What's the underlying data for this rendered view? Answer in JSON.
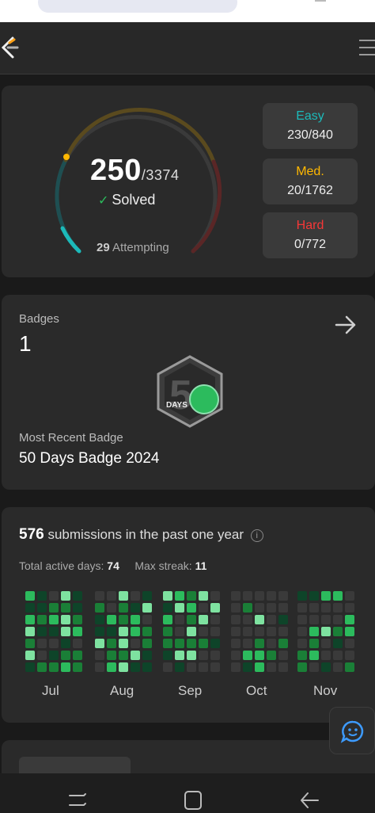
{
  "stats": {
    "solved": "250",
    "total": "/3374",
    "solved_label": "Solved",
    "attempting_count": "29",
    "attempting_label": "Attempting",
    "difficulties": [
      {
        "label": "Easy",
        "value": "230/840",
        "color": "#1cbaba"
      },
      {
        "label": "Med.",
        "value": "20/1762",
        "color": "#ffb800"
      },
      {
        "label": "Hard",
        "value": "0/772",
        "color": "#f63737"
      }
    ]
  },
  "badges": {
    "title": "Badges",
    "count": "1",
    "recent_label": "Most Recent Badge",
    "recent_name": "50 Days Badge 2024",
    "badge_text": "DAYS"
  },
  "submissions": {
    "count": "576",
    "text": "submissions in the past one year",
    "active_days_label": "Total active days:",
    "active_days": "74",
    "max_streak_label": "Max streak:",
    "max_streak": "11",
    "months": [
      "Jul",
      "Aug",
      "Sep",
      "Oct",
      "Nov"
    ]
  },
  "icons": {
    "logo": "leetcode-logo-icon",
    "menu": "hamburger-menu-icon",
    "arrow": "arrow-right-icon",
    "info": "info-icon",
    "chat": "chat-smiley-icon"
  },
  "colors": {
    "easy": "#1cbaba",
    "medium": "#ffb800",
    "hard": "#f63737",
    "accent_green": "#2cbb5d"
  }
}
